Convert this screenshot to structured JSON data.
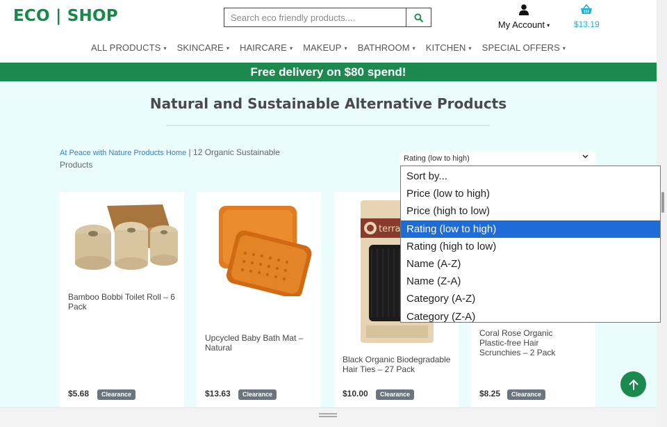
{
  "brand": {
    "logo": "ECO | SHOP"
  },
  "search": {
    "placeholder": "Search eco friendly products...."
  },
  "account": {
    "label": "My Account"
  },
  "basket": {
    "total": "$13.19"
  },
  "nav": [
    "ALL PRODUCTS",
    "SKINCARE",
    "HAIRCARE",
    "MAKEUP",
    "BATHROOM",
    "KITCHEN",
    "SPECIAL OFFERS"
  ],
  "banner": {
    "text": "Free delivery on $80 spend!"
  },
  "page": {
    "title": "Natural and Sustainable Alternative Products"
  },
  "breadcrumb": {
    "home_link": "At Peace with Nature Products Home",
    "separator": "|",
    "count_text": "12 Organic Sustainable Products"
  },
  "sort": {
    "selected": "Rating (low to high)",
    "options": [
      "Sort by...",
      "Price (low to high)",
      "Price (high to low)",
      "Rating (low to high)",
      "Rating (high to low)",
      "Name (A-Z)",
      "Name (Z-A)",
      "Category (A-Z)",
      "Category (Z-A)"
    ]
  },
  "products": [
    {
      "name": "Bamboo Bobbi Toilet Roll – 6 Pack",
      "price": "$5.68",
      "badge": "Clearance"
    },
    {
      "name": "Upcycled Baby Bath Mat – Natural",
      "price": "$13.63",
      "badge": "Clearance"
    },
    {
      "name": "Black Organic Biodegradable Hair Ties – 27 Pack",
      "price": "$10.00",
      "badge": "Clearance",
      "packaging_brand": "terra"
    },
    {
      "name": "Coral Rose Organic Plastic-free Hair Scrunchies – 2 Pack",
      "price": "$8.25",
      "badge": "Clearance"
    }
  ],
  "colors": {
    "brand_green": "#168a47",
    "banner_green": "#1c8a4f",
    "basket_blue": "#1ab0d8",
    "selected_option": "#1f6cd6",
    "badge_gray": "#6c757d"
  }
}
